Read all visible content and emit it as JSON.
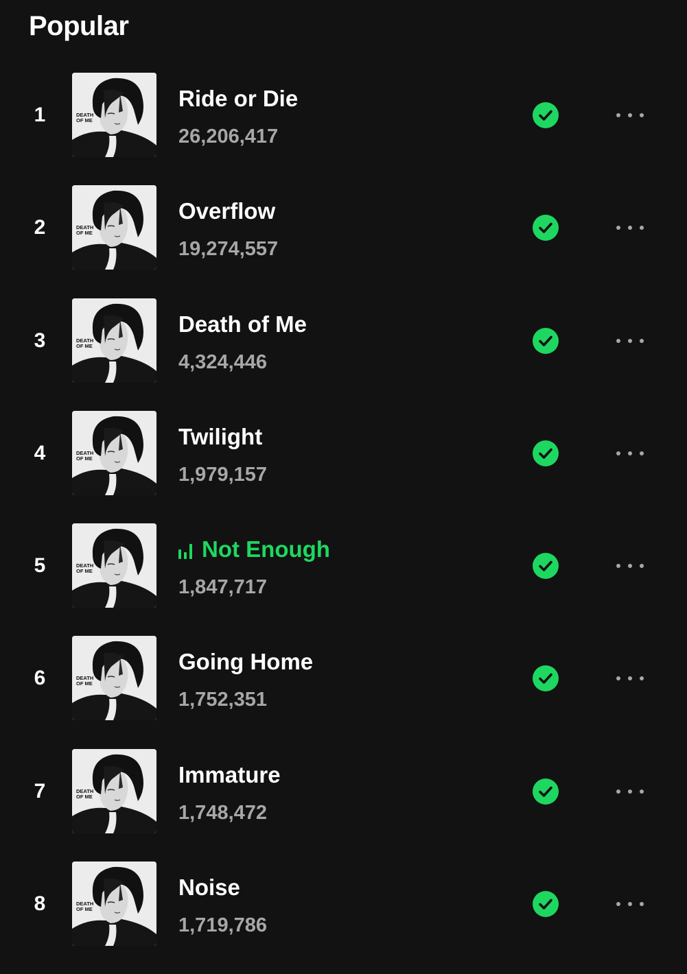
{
  "section": {
    "title": "Popular"
  },
  "colors": {
    "background": "#121212",
    "accent": "#1ed760",
    "secondary_text": "#a7a7a7"
  },
  "album_art": {
    "cover_text_line1": "DEATH",
    "cover_text_line2": "OF ME"
  },
  "tracks": [
    {
      "rank": "1",
      "title": "Ride or Die",
      "plays": "26,206,417",
      "saved": true,
      "playing": false
    },
    {
      "rank": "2",
      "title": "Overflow",
      "plays": "19,274,557",
      "saved": true,
      "playing": false
    },
    {
      "rank": "3",
      "title": "Death of Me",
      "plays": "4,324,446",
      "saved": true,
      "playing": false
    },
    {
      "rank": "4",
      "title": "Twilight",
      "plays": "1,979,157",
      "saved": true,
      "playing": false
    },
    {
      "rank": "5",
      "title": "Not Enough",
      "plays": "1,847,717",
      "saved": true,
      "playing": true
    },
    {
      "rank": "6",
      "title": "Going Home",
      "plays": "1,752,351",
      "saved": true,
      "playing": false
    },
    {
      "rank": "7",
      "title": "Immature",
      "plays": "1,748,472",
      "saved": true,
      "playing": false
    },
    {
      "rank": "8",
      "title": "Noise",
      "plays": "1,719,786",
      "saved": true,
      "playing": false
    }
  ],
  "icons": {
    "saved": "check-circle-icon",
    "more": "more-options-icon",
    "playing": "equalizer-icon"
  }
}
